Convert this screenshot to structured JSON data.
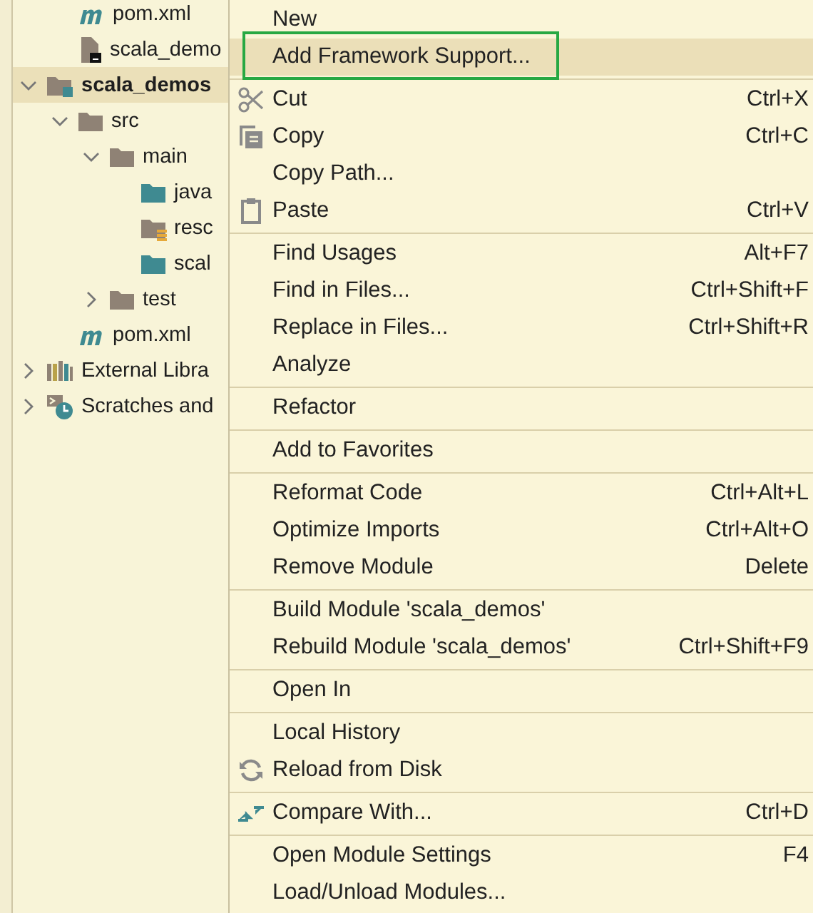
{
  "project_tree": [
    {
      "kind": "continuation",
      "children": [
        {
          "kind": "maven",
          "label": "pom.xml",
          "selected": false
        },
        {
          "kind": "file",
          "label": "scala_demo",
          "selected": false
        }
      ]
    },
    {
      "kind": "module",
      "label": "scala_demos",
      "selected": true,
      "expanded": true,
      "children": [
        {
          "kind": "folder",
          "label": "src",
          "selected": false,
          "expanded": true,
          "children": [
            {
              "kind": "folder",
              "label": "main",
              "selected": false,
              "expanded": true,
              "children": [
                {
                  "kind": "source-folder",
                  "label": "java",
                  "selected": false
                },
                {
                  "kind": "resource-folder",
                  "label": "resc",
                  "selected": false
                },
                {
                  "kind": "source-folder",
                  "label": "scal",
                  "selected": false
                }
              ]
            },
            {
              "kind": "folder",
              "label": "test",
              "selected": false,
              "expanded": false
            }
          ]
        },
        {
          "kind": "maven",
          "label": "pom.xml",
          "selected": false
        }
      ]
    },
    {
      "kind": "libraries",
      "label": "External Libra",
      "selected": false,
      "expanded": false
    },
    {
      "kind": "scratches",
      "label": "Scratches and",
      "selected": false,
      "expanded": false
    }
  ],
  "context_menu": [
    {
      "kind": "item",
      "label": "New",
      "selected": false,
      "outlined": false
    },
    {
      "kind": "item",
      "label": "Add Framework Support...",
      "selected": true,
      "outlined": true
    },
    {
      "kind": "separator"
    },
    {
      "kind": "cut",
      "label": "Cut",
      "shortcut": "Ctrl+X",
      "selected": false,
      "outlined": false
    },
    {
      "kind": "copy",
      "label": "Copy",
      "shortcut": "Ctrl+C",
      "selected": false,
      "outlined": false
    },
    {
      "kind": "item",
      "label": "Copy Path...",
      "selected": false,
      "outlined": false
    },
    {
      "kind": "paste",
      "label": "Paste",
      "shortcut": "Ctrl+V",
      "selected": false,
      "outlined": false
    },
    {
      "kind": "separator"
    },
    {
      "kind": "item",
      "label": "Find Usages",
      "shortcut": "Alt+F7",
      "selected": false,
      "outlined": false
    },
    {
      "kind": "item",
      "label": "Find in Files...",
      "shortcut": "Ctrl+Shift+F",
      "selected": false,
      "outlined": false
    },
    {
      "kind": "item",
      "label": "Replace in Files...",
      "shortcut": "Ctrl+Shift+R",
      "selected": false,
      "outlined": false
    },
    {
      "kind": "item",
      "label": "Analyze",
      "selected": false,
      "outlined": false
    },
    {
      "kind": "separator"
    },
    {
      "kind": "item",
      "label": "Refactor",
      "selected": false,
      "outlined": false
    },
    {
      "kind": "separator"
    },
    {
      "kind": "item",
      "label": "Add to Favorites",
      "selected": false,
      "outlined": false
    },
    {
      "kind": "separator"
    },
    {
      "kind": "item",
      "label": "Reformat Code",
      "shortcut": "Ctrl+Alt+L",
      "selected": false,
      "outlined": false
    },
    {
      "kind": "item",
      "label": "Optimize Imports",
      "shortcut": "Ctrl+Alt+O",
      "selected": false,
      "outlined": false
    },
    {
      "kind": "item",
      "label": "Remove Module",
      "shortcut": "Delete",
      "selected": false,
      "outlined": false
    },
    {
      "kind": "separator"
    },
    {
      "kind": "item",
      "label": "Build Module 'scala_demos'",
      "selected": false,
      "outlined": false
    },
    {
      "kind": "item",
      "label": "Rebuild Module 'scala_demos'",
      "shortcut": "Ctrl+Shift+F9",
      "selected": false,
      "outlined": false
    },
    {
      "kind": "separator"
    },
    {
      "kind": "item",
      "label": "Open In",
      "selected": false,
      "outlined": false
    },
    {
      "kind": "separator"
    },
    {
      "kind": "item",
      "label": "Local History",
      "selected": false,
      "outlined": false
    },
    {
      "kind": "reload",
      "label": "Reload from Disk",
      "selected": false,
      "outlined": false
    },
    {
      "kind": "separator"
    },
    {
      "kind": "compare",
      "label": "Compare With...",
      "shortcut": "Ctrl+D",
      "selected": false,
      "outlined": false
    },
    {
      "kind": "separator"
    },
    {
      "kind": "item",
      "label": "Open Module Settings",
      "shortcut": "F4",
      "selected": false,
      "outlined": false
    },
    {
      "kind": "item",
      "label": "Load/Unload Modules...",
      "selected": false,
      "outlined": false
    }
  ]
}
